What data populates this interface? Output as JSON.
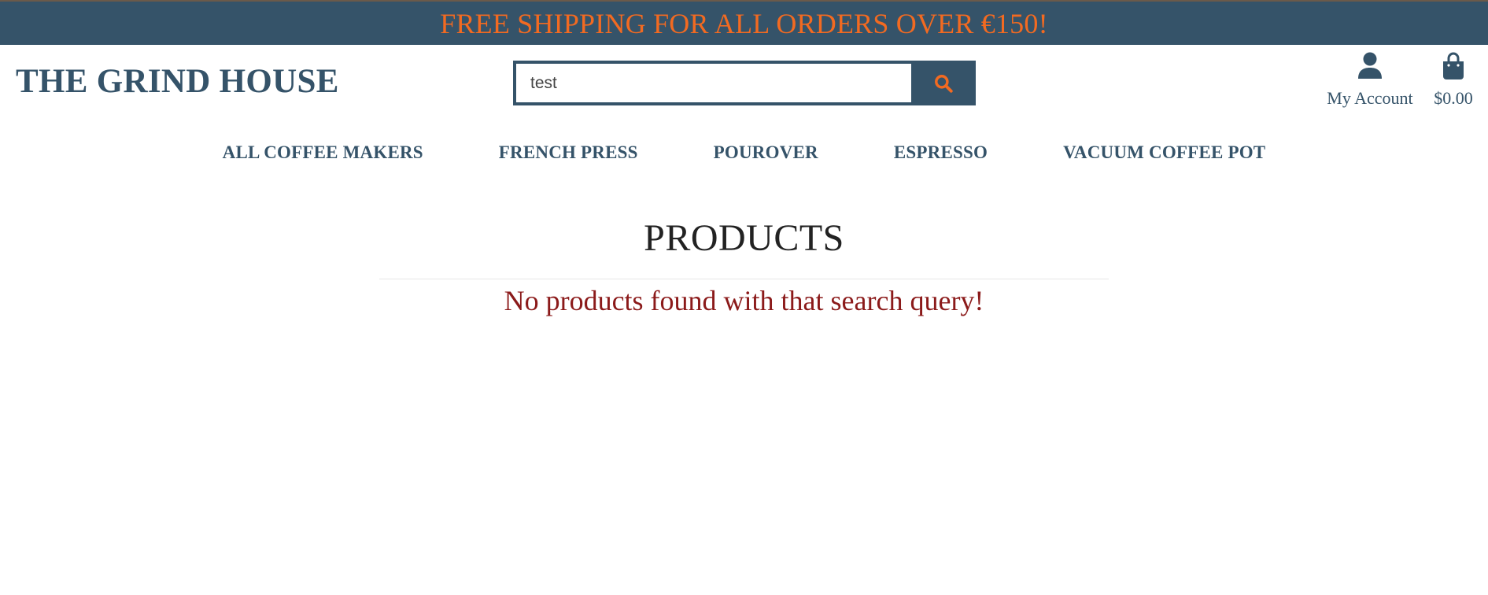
{
  "banner": {
    "text": "FREE SHIPPING FOR ALL ORDERS OVER €150!"
  },
  "header": {
    "logo": "THE GRIND HOUSE",
    "search": {
      "value": "test",
      "icon": "search-icon"
    },
    "account": {
      "label": "My Account",
      "icon": "user-icon"
    },
    "bag": {
      "total": "$0.00",
      "icon": "shopping-bag-icon"
    }
  },
  "nav": {
    "items": [
      {
        "label": "ALL COFFEE MAKERS"
      },
      {
        "label": "FRENCH PRESS"
      },
      {
        "label": "POUROVER"
      },
      {
        "label": "ESPRESSO"
      },
      {
        "label": "VACUUM COFFEE POT"
      }
    ]
  },
  "main": {
    "title": "PRODUCTS",
    "empty_message": "No products found with that search query!"
  },
  "colors": {
    "primary": "#355369",
    "accent": "#f26a21",
    "error": "#8b1a1a"
  }
}
